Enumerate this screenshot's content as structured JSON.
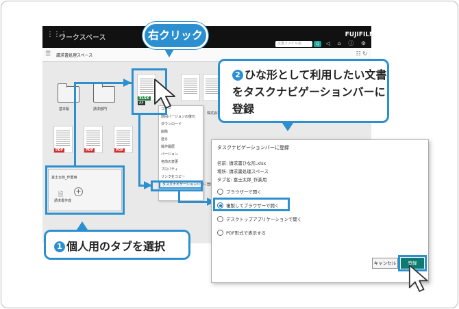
{
  "app": {
    "workspace_title": "ワークスペース",
    "brand": "FUJIFILM",
    "search_placeholder": "文書ファイル名",
    "breadcrumb": "請求書処理スペース"
  },
  "folders": [
    {
      "label": "基本帳"
    },
    {
      "label": "請求部門"
    }
  ],
  "documents": {
    "selected": {
      "type": "XLSX",
      "size": "A4"
    },
    "others": [
      "PDF",
      "PDF",
      "PDF"
    ],
    "label_right": "株式会社"
  },
  "context_menu": {
    "items": [
      "コピー",
      "前回バージョンの復元",
      "ダウンロード",
      "削除",
      "送る",
      "操作履歴",
      "バージョン",
      "名前の変更",
      "プロパティ",
      "リンクをコピー",
      "タスクナビゲーションバーに登録"
    ],
    "highlighted_index": 10
  },
  "personal_tab": {
    "title": "富士太郎_作業用",
    "item_label": "請求書作成"
  },
  "callouts": {
    "right_click": "右クリック",
    "step2_number": "2",
    "step2_text": "ひな形として利用したい文書をタスクナビゲーションバーに登録",
    "step1_number": "1",
    "step1_text": "個人用のタブを選択"
  },
  "dialog": {
    "title": "タスクナビゲーションバーに登録",
    "name_line": "名前: 請求書ひな形.xlsx",
    "location_line": "場所: 請求書処理スペース",
    "tab_line": "タブ名: 富士太郎_作業用",
    "options": [
      {
        "label": "ブラウザーで開く",
        "selected": false
      },
      {
        "label": "複製してブラウザーで開く",
        "selected": true
      },
      {
        "label": "デスクトップアプリケーションで開く",
        "selected": false
      },
      {
        "label": "PDF形式で表示する",
        "selected": false
      }
    ],
    "cancel_label": "キャンセル",
    "ok_label": "登録"
  },
  "colors": {
    "accent": "#2b8fd0",
    "ok_button": "#0f7a72",
    "topbar": "#111111"
  }
}
